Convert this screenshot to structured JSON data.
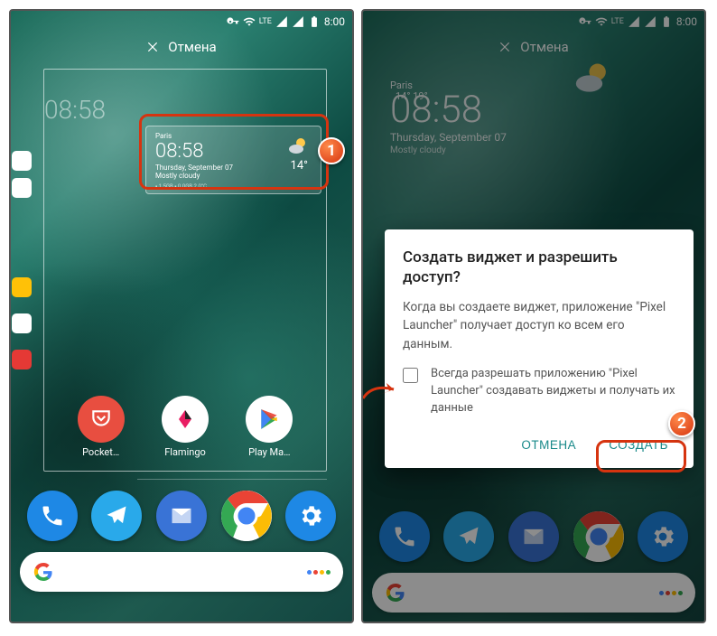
{
  "status": {
    "lte": "LTE",
    "time": "8:00"
  },
  "cancel_label": "Отмена",
  "widget": {
    "city": "Paris",
    "clock": "08:58",
    "date_line1": "Thursday, September 07",
    "date_line2": "Mostly cloudy",
    "temp": "14°",
    "battery_line": "▪ 1.5GB ▪ 0.0GB 2.0°C"
  },
  "apps": {
    "pocket": "Pocket…",
    "flamingo": "Flamingo",
    "play": "Play Ma…"
  },
  "dialog": {
    "title": "Создать виджет и разрешить доступ?",
    "body": "Когда вы создаете виджет, приложение \"Pixel Launcher\" получает доступ ко всем его данным.",
    "checkbox_label": "Всегда разрешать приложению \"Pixel Launcher\" создавать виджеты и получать их данные",
    "cancel": "ОТМЕНА",
    "create": "СОЗДАТЬ"
  },
  "widget_static": {
    "city": "Paris",
    "clock": "08:58",
    "date": "Thursday, September 07",
    "sub": "Mostly cloudy",
    "temp": "14° 19°"
  },
  "callouts": {
    "one": "1",
    "two": "2"
  },
  "colors": {
    "phone": "#1e88e5",
    "telegram": "#29a9ea",
    "inbox": "#3973d6",
    "chrome_y": "#fbbc05",
    "chrome_r": "#ea4335",
    "chrome_g": "#34a853",
    "chrome_b": "#4285f4",
    "settings": "#1e88e5",
    "pocket": "#e84e40",
    "flamingo": "#fff",
    "play": "#fff",
    "g_blue": "#4285f4",
    "g_red": "#ea4335",
    "g_yellow": "#fbbc05",
    "g_green": "#34a853"
  }
}
